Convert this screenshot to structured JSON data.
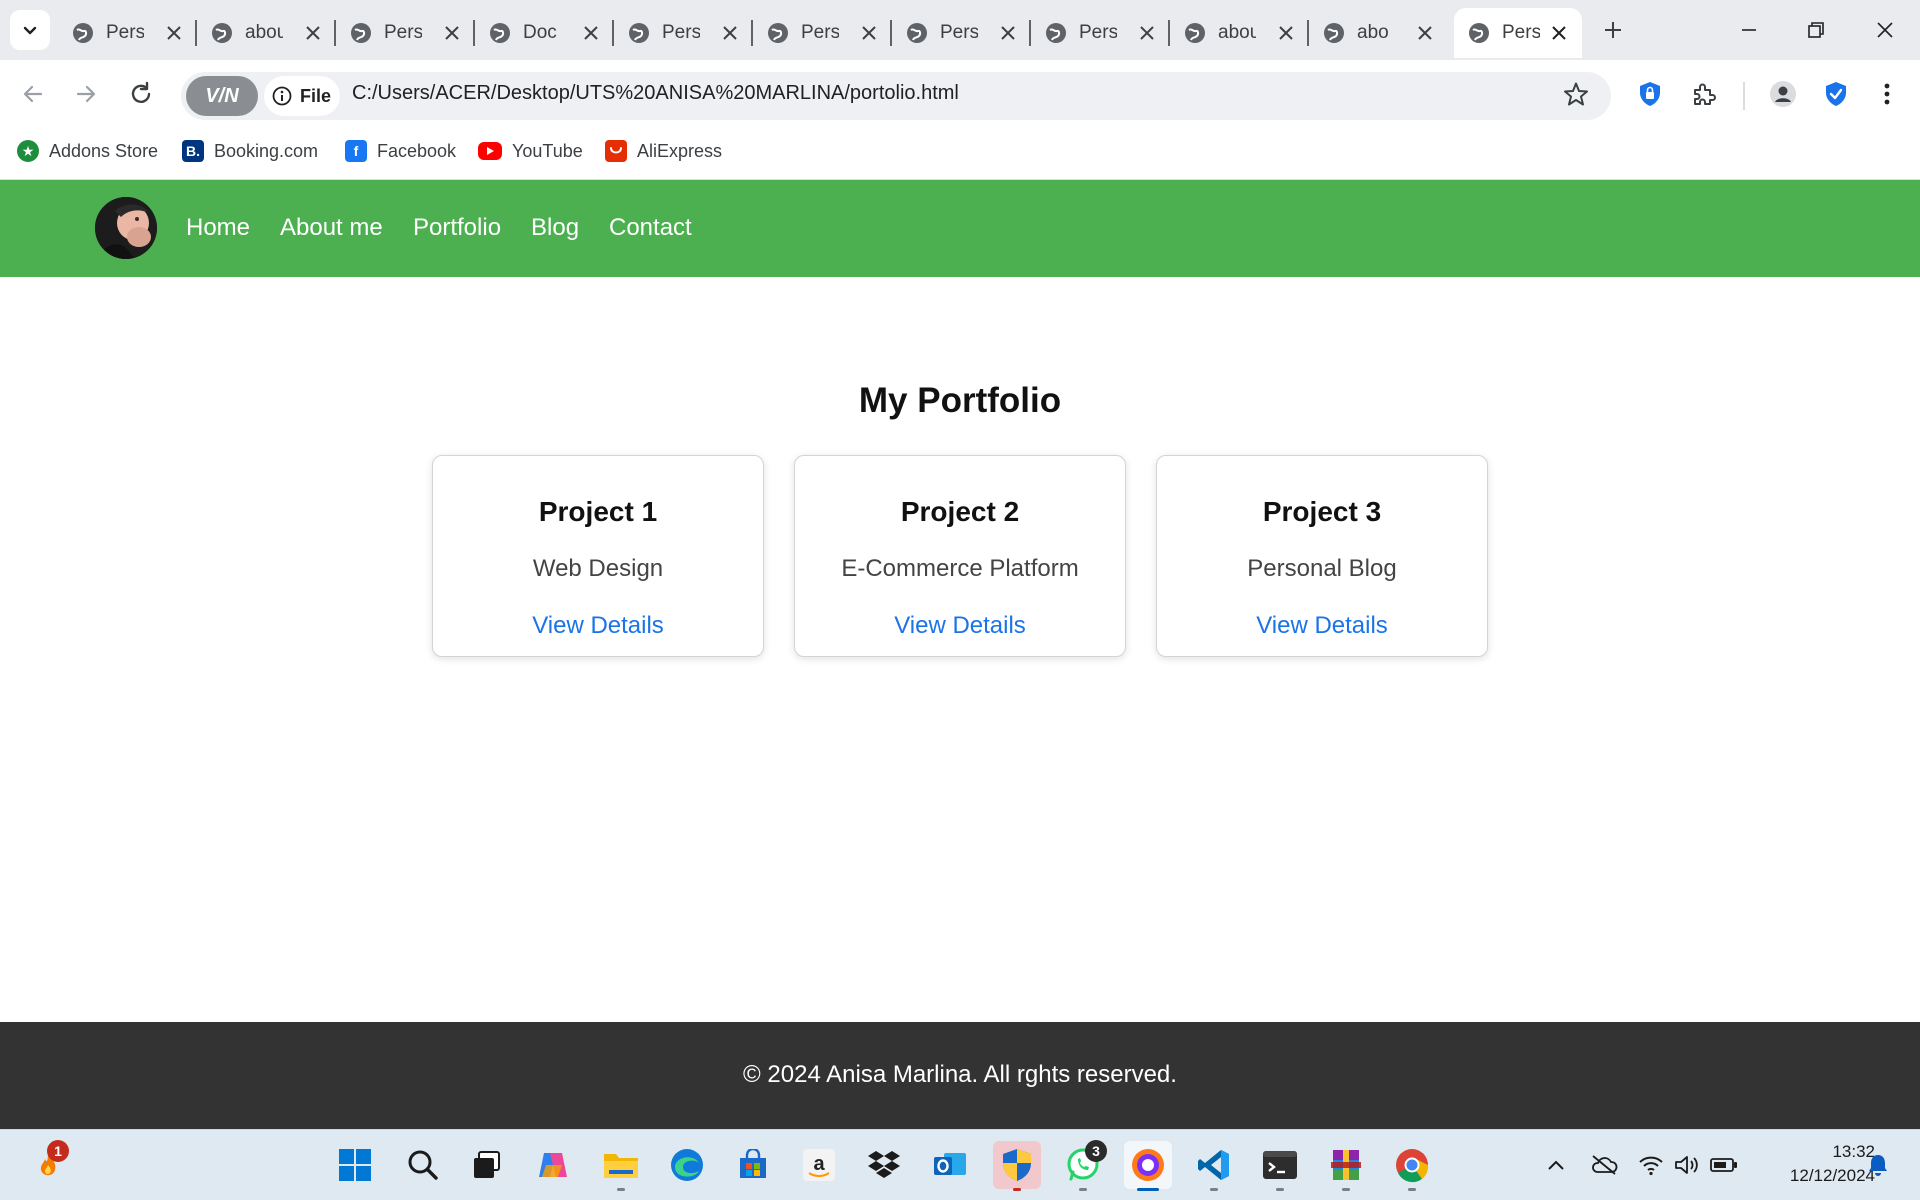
{
  "browser": {
    "tabs": [
      {
        "title": "Pers",
        "active": false
      },
      {
        "title": "abou",
        "active": false
      },
      {
        "title": "Pers",
        "active": false
      },
      {
        "title": "Doc",
        "active": false
      },
      {
        "title": "Pers",
        "active": false
      },
      {
        "title": "Pers",
        "active": false
      },
      {
        "title": "Pers",
        "active": false
      },
      {
        "title": "Pers",
        "active": false
      },
      {
        "title": "abou",
        "active": false
      },
      {
        "title": "abo",
        "active": false
      },
      {
        "title": "Pers",
        "active": true
      }
    ],
    "vpn_label": "V/N",
    "site_info_label": "File",
    "url": "C:/Users/ACER/Desktop/UTS%20ANISA%20MARLINA/portolio.html",
    "bookmarks": [
      {
        "label": "Addons Store",
        "icon": "addons-store-icon",
        "color": "#1e8e3e"
      },
      {
        "label": "Booking.com",
        "icon": "booking-icon",
        "color": "#003580"
      },
      {
        "label": "Facebook",
        "icon": "facebook-icon",
        "color": "#1877f2"
      },
      {
        "label": "YouTube",
        "icon": "youtube-icon",
        "color": "#ff0000"
      },
      {
        "label": "AliExpress",
        "icon": "aliexpress-icon",
        "color": "#e62e04"
      }
    ]
  },
  "page": {
    "nav": {
      "links": [
        "Home",
        "About me",
        "Portfolio",
        "Blog",
        "Contact"
      ],
      "bg_color": "#4caf50"
    },
    "heading": "My Portfolio",
    "projects": [
      {
        "title": "Project 1",
        "description": "Web Design",
        "link": "View Details"
      },
      {
        "title": "Project 2",
        "description": "E-Commerce Platform",
        "link": "View Details"
      },
      {
        "title": "Project 3",
        "description": "Personal Blog",
        "link": "View Details"
      }
    ],
    "footer": "© 2024 Anisa Marlina. All rghts reserved."
  },
  "taskbar": {
    "widgets_badge": "1",
    "whatsapp_badge": "3",
    "apps": [
      "start-icon",
      "search-icon",
      "task-view-icon",
      "copilot-icon",
      "file-explorer-icon",
      "edge-icon",
      "store-icon",
      "amazon-icon",
      "dropbox-icon",
      "outlook-icon",
      "security-icon",
      "whatsapp-icon",
      "browser-icon",
      "vscode-icon",
      "terminal-icon",
      "winrar-icon",
      "chrome-icon"
    ],
    "time": "13:32",
    "date": "12/12/2024"
  }
}
